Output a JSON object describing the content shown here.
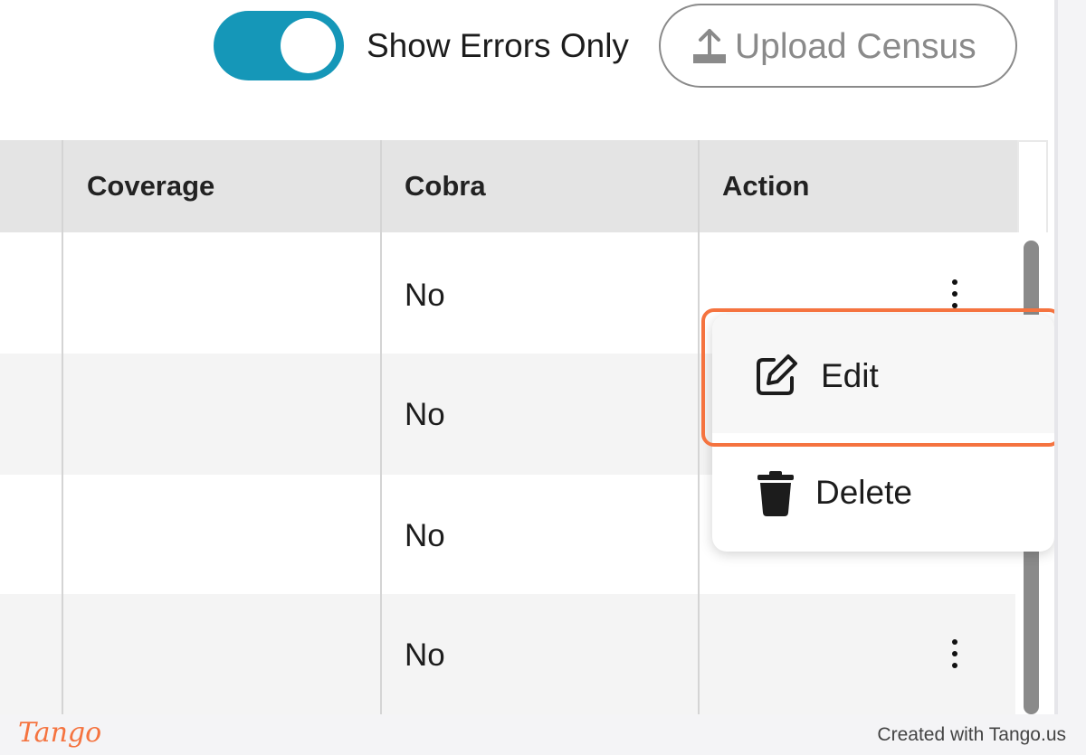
{
  "toolbar": {
    "toggle_label": "Show Errors Only",
    "toggle_on": true,
    "upload_label": "Upload Census"
  },
  "table": {
    "columns": [
      "Coverage",
      "Cobra",
      "Action"
    ],
    "rows": [
      {
        "coverage": "",
        "cobra": "No"
      },
      {
        "coverage": "",
        "cobra": "No"
      },
      {
        "coverage": "",
        "cobra": "No"
      },
      {
        "coverage": "",
        "cobra": "No"
      }
    ]
  },
  "menu": {
    "items": [
      {
        "label": "Edit",
        "icon": "pencil-square-icon"
      },
      {
        "label": "Delete",
        "icon": "trash-icon"
      }
    ]
  },
  "footer": {
    "logo": "Tango",
    "credit": "Created with Tango.us"
  },
  "colors": {
    "toggle_accent": "#1597b8",
    "highlight": "#f5733f"
  }
}
